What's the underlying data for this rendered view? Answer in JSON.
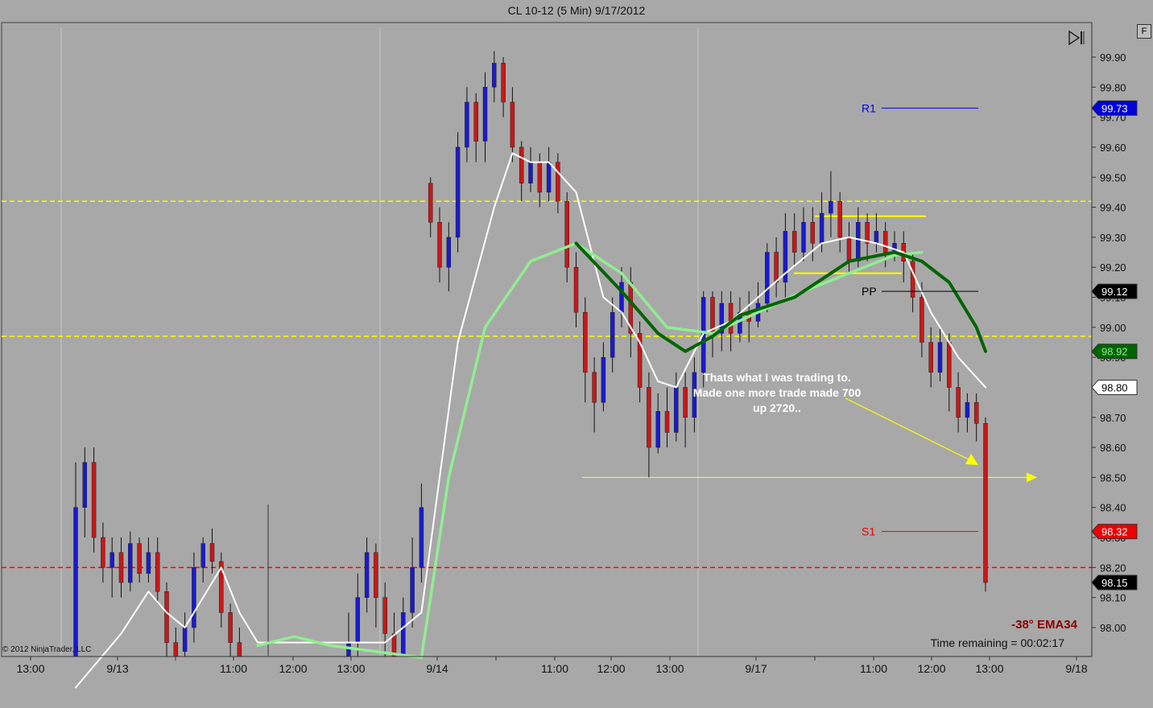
{
  "title": "CL 10-12 (5 Min)  9/17/2012",
  "copyright": "© 2012 NinjaTrader, LLC",
  "note_lines": [
    "Thats what I was trading to.",
    "Made one more trade made 700",
    "up 2720.."
  ],
  "ema_label": "-38° EMA34",
  "time_remaining": "Time remaining = 00:02:17",
  "f_button": "F",
  "colors": {
    "background": "#a8a8a8",
    "up": "#1a1acc",
    "down": "#c81818",
    "ema_fast": "#ffffff",
    "ema_slow": "#90ee90",
    "ema34": "#006400",
    "hline_yellow": "#ffff00",
    "hline_red": "#ff0000"
  },
  "chart_data": {
    "type": "candlestick",
    "y_axis": {
      "ticks": [
        "99.90",
        "99.80",
        "99.70",
        "99.60",
        "99.50",
        "99.40",
        "99.30",
        "99.20",
        "99.10",
        "99.00",
        "98.90",
        "98.80",
        "98.70",
        "98.60",
        "98.50",
        "98.40",
        "98.30",
        "98.20",
        "98.10",
        "98.00"
      ],
      "range": [
        97.9,
        99.95
      ]
    },
    "x_axis": {
      "ticks": [
        "13:00",
        "9/13",
        "11:00",
        "12:00",
        "13:00",
        "9/14",
        "11:00",
        "12:00",
        "13:00",
        "9/17",
        "11:00",
        "12:00",
        "13:00",
        "9/18"
      ]
    },
    "price_markers": [
      {
        "label": "99.73",
        "value": 99.73,
        "bg": "#0000dd",
        "fg": "#ffffff"
      },
      {
        "label": "99.12",
        "value": 99.12,
        "bg": "#000000",
        "fg": "#ffffff"
      },
      {
        "label": "98.92",
        "value": 98.92,
        "bg": "#006400",
        "fg": "#90ee90"
      },
      {
        "label": "98.80",
        "value": 98.8,
        "bg": "#ffffff",
        "fg": "#000000"
      },
      {
        "label": "98.32",
        "value": 98.32,
        "bg": "#ee0000",
        "fg": "#ffffff"
      },
      {
        "label": "98.15",
        "value": 98.15,
        "bg": "#000000",
        "fg": "#ffffff"
      }
    ],
    "pivot_levels": [
      {
        "label": "R1",
        "value": 99.73,
        "color": "#0000ee"
      },
      {
        "label": "PP",
        "value": 99.12,
        "color": "#000000"
      },
      {
        "label": "S1",
        "value": 98.32,
        "color": "#ee0000"
      }
    ],
    "horizontal_lines": [
      {
        "value": 99.42,
        "color": "#ffff00",
        "style": "dashed"
      },
      {
        "value": 98.97,
        "color": "#ffff00",
        "style": "dashed"
      },
      {
        "value": 98.2,
        "color": "#ff0000",
        "style": "dashed"
      },
      {
        "value": 98.5,
        "color": "#ffff00",
        "style": "solid",
        "arrow": true
      },
      {
        "value": 99.37,
        "color": "#ffff00",
        "style": "solid"
      },
      {
        "value": 99.18,
        "color": "#ffff00",
        "style": "solid"
      }
    ],
    "series": [
      {
        "kind": "candles",
        "points": [
          [
            0,
            97.88,
            98.4,
            97.85,
            98.55
          ],
          [
            1,
            98.4,
            98.55,
            98.3,
            98.6
          ],
          [
            2,
            98.55,
            98.3,
            98.25,
            98.6
          ],
          [
            3,
            98.3,
            98.2,
            98.15,
            98.35
          ],
          [
            4,
            98.2,
            98.25,
            98.1,
            98.3
          ],
          [
            5,
            98.25,
            98.15,
            98.1,
            98.3
          ],
          [
            6,
            98.15,
            98.28,
            98.12,
            98.32
          ],
          [
            7,
            98.28,
            98.18,
            98.15,
            98.3
          ],
          [
            8,
            98.18,
            98.25,
            98.15,
            98.3
          ],
          [
            9,
            98.25,
            98.12,
            98.08,
            98.3
          ],
          [
            10,
            98.12,
            97.95,
            97.9,
            98.15
          ],
          [
            11,
            97.95,
            97.9,
            97.88,
            98.0
          ],
          [
            12,
            97.92,
            98.0,
            97.88,
            98.05
          ],
          [
            13,
            98.0,
            98.2,
            97.95,
            98.25
          ],
          [
            14,
            98.2,
            98.28,
            98.15,
            98.3
          ],
          [
            15,
            98.28,
            98.22,
            98.18,
            98.33
          ],
          [
            16,
            98.22,
            98.05,
            98.0,
            98.25
          ],
          [
            17,
            98.05,
            97.95,
            97.9,
            98.08
          ],
          [
            18,
            97.95,
            97.9,
            97.88,
            98.0
          ],
          [
            30,
            97.88,
            97.95,
            97.85,
            98.05
          ],
          [
            31,
            97.95,
            98.1,
            97.9,
            98.18
          ],
          [
            32,
            98.1,
            98.25,
            98.05,
            98.3
          ],
          [
            33,
            98.25,
            98.1,
            98.0,
            98.28
          ],
          [
            34,
            98.1,
            97.98,
            97.9,
            98.15
          ],
          [
            35,
            97.98,
            97.9,
            97.88,
            98.05
          ],
          [
            36,
            97.9,
            98.05,
            97.88,
            98.1
          ],
          [
            37,
            98.05,
            98.2,
            98.0,
            98.3
          ],
          [
            38,
            98.2,
            98.4,
            98.15,
            98.48
          ],
          [
            39,
            99.48,
            99.35,
            99.3,
            99.5
          ],
          [
            40,
            99.35,
            99.2,
            99.15,
            99.4
          ],
          [
            41,
            99.2,
            99.3,
            99.12,
            99.35
          ],
          [
            42,
            99.3,
            99.6,
            99.25,
            99.65
          ],
          [
            43,
            99.6,
            99.75,
            99.55,
            99.8
          ],
          [
            44,
            99.75,
            99.62,
            99.55,
            99.78
          ],
          [
            45,
            99.62,
            99.8,
            99.55,
            99.85
          ],
          [
            46,
            99.8,
            99.88,
            99.75,
            99.92
          ],
          [
            47,
            99.88,
            99.75,
            99.7,
            99.9
          ],
          [
            48,
            99.75,
            99.6,
            99.55,
            99.8
          ],
          [
            49,
            99.6,
            99.48,
            99.42,
            99.62
          ],
          [
            50,
            99.48,
            99.55,
            99.45,
            99.6
          ],
          [
            51,
            99.55,
            99.45,
            99.4,
            99.58
          ],
          [
            52,
            99.45,
            99.55,
            99.42,
            99.6
          ],
          [
            53,
            99.55,
            99.42,
            99.38,
            99.58
          ],
          [
            54,
            99.42,
            99.2,
            99.15,
            99.45
          ],
          [
            55,
            99.2,
            99.05,
            99.0,
            99.25
          ],
          [
            56,
            99.05,
            98.85,
            98.75,
            99.1
          ],
          [
            57,
            98.85,
            98.75,
            98.65,
            98.9
          ],
          [
            58,
            98.75,
            98.9,
            98.72,
            98.95
          ],
          [
            59,
            98.9,
            99.05,
            98.85,
            99.1
          ],
          [
            60,
            99.05,
            99.15,
            99.0,
            99.2
          ],
          [
            61,
            99.15,
            98.98,
            98.9,
            99.2
          ],
          [
            62,
            98.98,
            98.8,
            98.75,
            99.02
          ],
          [
            63,
            98.8,
            98.6,
            98.5,
            98.85
          ],
          [
            64,
            98.6,
            98.72,
            98.58,
            98.78
          ],
          [
            65,
            98.72,
            98.65,
            98.6,
            98.8
          ],
          [
            66,
            98.65,
            98.8,
            98.62,
            98.85
          ],
          [
            67,
            98.8,
            98.7,
            98.6,
            98.85
          ],
          [
            68,
            98.7,
            98.85,
            98.65,
            98.9
          ],
          [
            69,
            98.85,
            99.1,
            98.8,
            99.12
          ],
          [
            70,
            99.1,
            98.98,
            98.9,
            99.12
          ],
          [
            71,
            98.98,
            99.08,
            98.92,
            99.12
          ],
          [
            72,
            99.08,
            98.98,
            98.92,
            99.12
          ],
          [
            73,
            98.98,
            99.05,
            98.95,
            99.1
          ],
          [
            74,
            99.05,
            99.02,
            98.95,
            99.12
          ],
          [
            75,
            99.02,
            99.08,
            99.0,
            99.15
          ],
          [
            76,
            99.08,
            99.25,
            99.05,
            99.28
          ],
          [
            77,
            99.25,
            99.15,
            99.1,
            99.3
          ],
          [
            78,
            99.15,
            99.32,
            99.1,
            99.38
          ],
          [
            79,
            99.32,
            99.25,
            99.2,
            99.38
          ],
          [
            80,
            99.25,
            99.35,
            99.22,
            99.4
          ],
          [
            81,
            99.35,
            99.28,
            99.22,
            99.4
          ],
          [
            82,
            99.28,
            99.38,
            99.25,
            99.45
          ],
          [
            83,
            99.38,
            99.42,
            99.3,
            99.52
          ],
          [
            84,
            99.42,
            99.3,
            99.25,
            99.45
          ],
          [
            85,
            99.3,
            99.22,
            99.18,
            99.35
          ],
          [
            86,
            99.22,
            99.35,
            99.2,
            99.4
          ],
          [
            87,
            99.35,
            99.28,
            99.22,
            99.38
          ],
          [
            88,
            99.28,
            99.32,
            99.25,
            99.38
          ],
          [
            89,
            99.32,
            99.25,
            99.2,
            99.35
          ],
          [
            90,
            99.25,
            99.28,
            99.22,
            99.32
          ],
          [
            91,
            99.28,
            99.22,
            99.15,
            99.32
          ],
          [
            92,
            99.22,
            99.1,
            99.05,
            99.25
          ],
          [
            93,
            99.1,
            98.95,
            98.9,
            99.15
          ],
          [
            94,
            98.95,
            98.85,
            98.8,
            99.0
          ],
          [
            95,
            98.85,
            98.95,
            98.82,
            99.0
          ],
          [
            96,
            98.95,
            98.8,
            98.72,
            98.98
          ],
          [
            97,
            98.8,
            98.7,
            98.65,
            98.85
          ],
          [
            98,
            98.7,
            98.75,
            98.65,
            98.78
          ],
          [
            99,
            98.75,
            98.68,
            98.62,
            98.78
          ],
          [
            100,
            98.68,
            98.15,
            98.12,
            98.7
          ]
        ]
      },
      {
        "kind": "line",
        "name": "",
        "color": "#ffffff",
        "points": [
          [
            0,
            97.8
          ],
          [
            5,
            97.98
          ],
          [
            8,
            98.12
          ],
          [
            10,
            98.05
          ],
          [
            12,
            98.0
          ],
          [
            16,
            98.2
          ],
          [
            18,
            98.05
          ],
          [
            20,
            97.95
          ],
          [
            34,
            97.95
          ],
          [
            38,
            98.05
          ],
          [
            42,
            98.95
          ],
          [
            46,
            99.4
          ],
          [
            48,
            99.58
          ],
          [
            50,
            99.55
          ],
          [
            52,
            99.55
          ],
          [
            55,
            99.45
          ],
          [
            58,
            99.1
          ],
          [
            60,
            99.05
          ],
          [
            62,
            98.95
          ],
          [
            64,
            98.82
          ],
          [
            66,
            98.8
          ],
          [
            69,
            98.98
          ],
          [
            72,
            99.02
          ],
          [
            75,
            99.1
          ],
          [
            78,
            99.18
          ],
          [
            82,
            99.28
          ],
          [
            85,
            99.3
          ],
          [
            88,
            99.28
          ],
          [
            91,
            99.25
          ],
          [
            94,
            99.05
          ],
          [
            97,
            98.9
          ],
          [
            100,
            98.8
          ]
        ]
      },
      {
        "kind": "line",
        "name": "",
        "color": "#90ee90",
        "points": [
          [
            20,
            97.94
          ],
          [
            24,
            97.97
          ],
          [
            28,
            97.94
          ],
          [
            38,
            97.9
          ],
          [
            41,
            98.5
          ],
          [
            45,
            99.0
          ],
          [
            50,
            99.22
          ],
          [
            55,
            99.28
          ],
          [
            60,
            99.18
          ],
          [
            65,
            99.0
          ],
          [
            70,
            98.98
          ],
          [
            75,
            99.05
          ],
          [
            80,
            99.12
          ],
          [
            85,
            99.18
          ],
          [
            90,
            99.24
          ],
          [
            93,
            99.25
          ]
        ]
      },
      {
        "kind": "line",
        "name": "",
        "color": "#006400",
        "points": [
          [
            55,
            99.28
          ],
          [
            60,
            99.12
          ],
          [
            64,
            98.98
          ],
          [
            67,
            98.92
          ],
          [
            70,
            98.97
          ],
          [
            73,
            99.04
          ],
          [
            76,
            99.07
          ],
          [
            79,
            99.1
          ],
          [
            85,
            99.22
          ],
          [
            90,
            99.25
          ],
          [
            93,
            99.22
          ],
          [
            96,
            99.15
          ],
          [
            99,
            99.0
          ],
          [
            100,
            98.92
          ]
        ]
      }
    ]
  }
}
